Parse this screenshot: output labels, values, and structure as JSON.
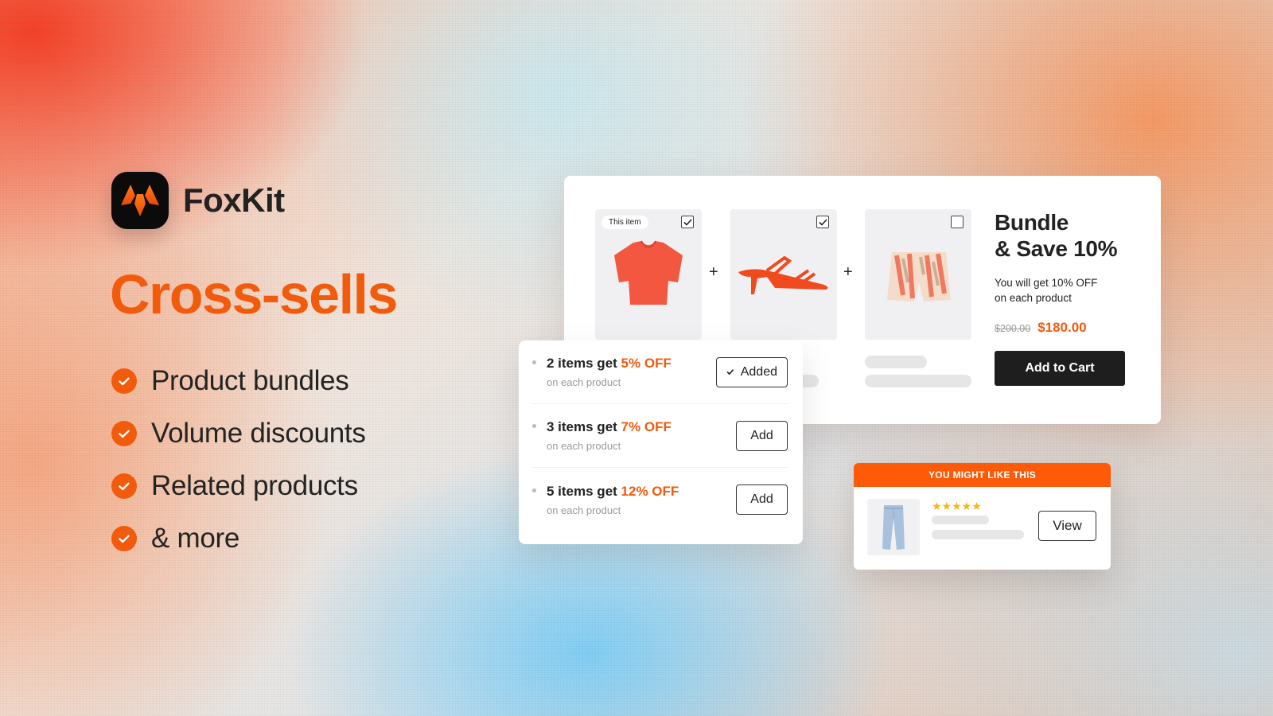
{
  "brand": {
    "name": "FoxKit",
    "logo_icon": "fox-logo-icon",
    "accent_color": "#f25a0c"
  },
  "hero": {
    "headline": "Cross-sells",
    "features": [
      {
        "icon": "check-circle-icon",
        "label": "Product bundles"
      },
      {
        "icon": "check-circle-icon",
        "label": "Volume discounts"
      },
      {
        "icon": "check-circle-icon",
        "label": "Related products"
      },
      {
        "icon": "check-circle-icon",
        "label": "& more"
      }
    ]
  },
  "bundle": {
    "products": [
      {
        "image": "orange-top",
        "tag": "This item",
        "checked": true
      },
      {
        "image": "orange-sandal",
        "checked": true
      },
      {
        "image": "floral-shorts",
        "checked": false
      }
    ],
    "separator": "+",
    "title_line1": "Bundle",
    "title_line2": "& Save 10%",
    "description_line1": "You will get 10% OFF",
    "description_line2": "on each product",
    "original_price": "$200.00",
    "sale_price": "$180.00",
    "cta_label": "Add to Cart"
  },
  "volume_discounts": {
    "tiers": [
      {
        "prefix": "2 items get ",
        "discount": "5% OFF",
        "sub": "on each product",
        "button": "Added",
        "added": true
      },
      {
        "prefix": "3 items get ",
        "discount": "7% OFF",
        "sub": "on each product",
        "button": "Add",
        "added": false
      },
      {
        "prefix": "5 items get ",
        "discount": "12% OFF",
        "sub": "on each product",
        "button": "Add",
        "added": false
      }
    ]
  },
  "related": {
    "header": "YOU MIGHT LIKE THIS",
    "image": "jeans",
    "rating": 5,
    "rating_max": 5,
    "stars": "★★★★★",
    "button": "View"
  }
}
